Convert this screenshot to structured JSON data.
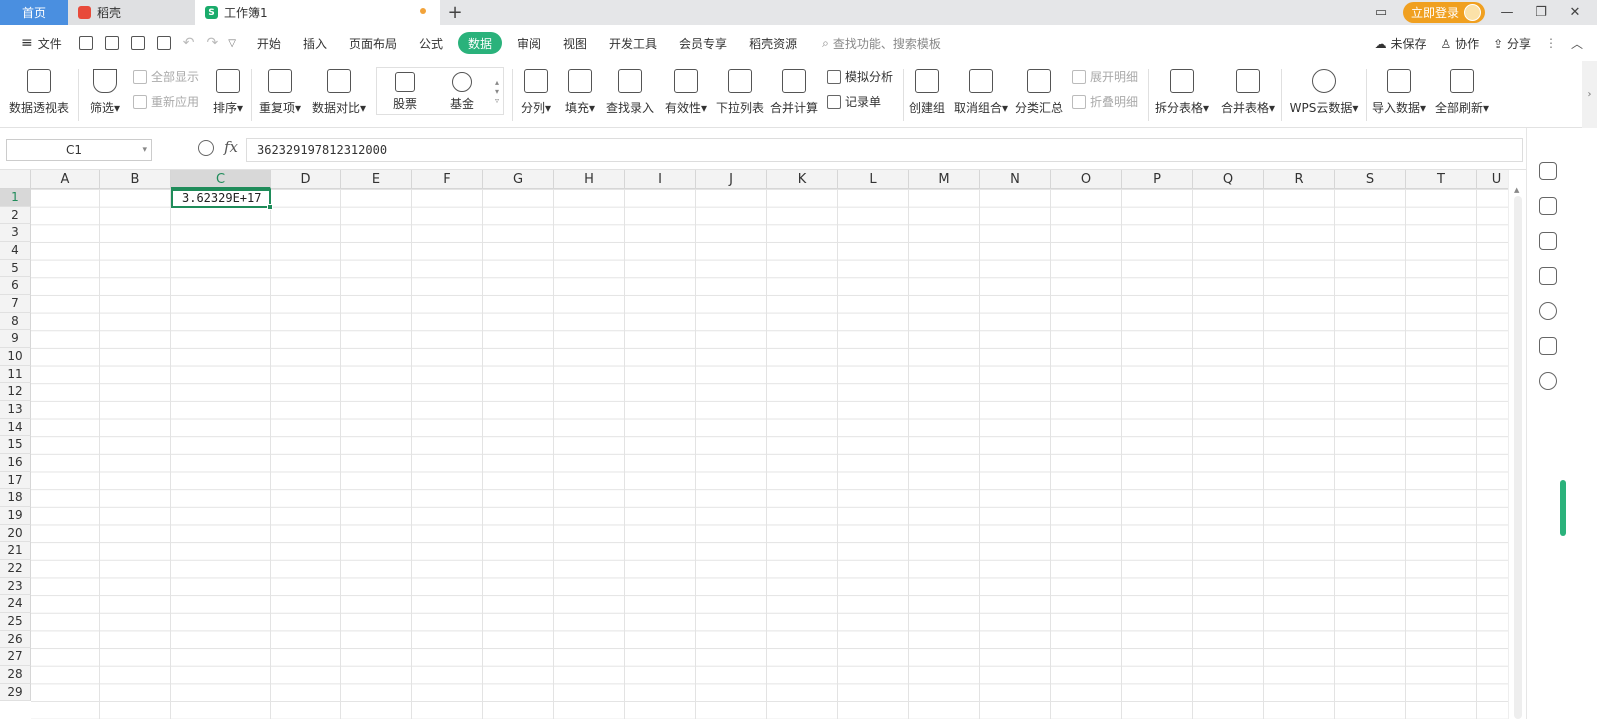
{
  "tabs": {
    "home": "首页",
    "daoke": "稻壳",
    "workbook": "工作簿1",
    "login": "立即登录"
  },
  "menu": {
    "file": "文件",
    "items": [
      "开始",
      "插入",
      "页面布局",
      "公式",
      "数据",
      "审阅",
      "视图",
      "开发工具",
      "会员专享",
      "稻壳资源"
    ],
    "active_index": 4,
    "search_placeholder": "查找功能、搜索模板",
    "unsaved": "未保存",
    "collab": "协作",
    "share": "分享"
  },
  "ribbon": {
    "pivot": "数据透视表",
    "filter": "筛选",
    "show_all": "全部显示",
    "reapply": "重新应用",
    "sort": "排序",
    "duplicates": "重复项",
    "compare": "数据对比",
    "stock": "股票",
    "fund": "基金",
    "split": "分列",
    "fill": "填充",
    "lookup": "查找录入",
    "validity": "有效性",
    "dropdown": "下拉列表",
    "consolidate": "合并计算",
    "simulate": "模拟分析",
    "record": "记录单",
    "group": "创建组",
    "ungroup": "取消组合",
    "subtotal": "分类汇总",
    "expand": "展开明细",
    "collapse": "折叠明细",
    "split_table": "拆分表格",
    "merge_table": "合并表格",
    "wps_cloud": "WPS云数据",
    "import": "导入数据",
    "refresh_all": "全部刷新"
  },
  "formula_bar": {
    "name_box": "C1",
    "fx": "fx",
    "content": "362329197812312000"
  },
  "sheet": {
    "columns": [
      "A",
      "B",
      "C",
      "D",
      "E",
      "F",
      "G",
      "H",
      "I",
      "J",
      "K",
      "L",
      "M",
      "N",
      "O",
      "P",
      "Q",
      "R",
      "S",
      "T",
      "U"
    ],
    "rows": [
      "1",
      "2",
      "3",
      "4",
      "5",
      "6",
      "7",
      "8",
      "9",
      "10",
      "11",
      "12",
      "13",
      "14",
      "15",
      "16",
      "17",
      "18",
      "19",
      "20",
      "21",
      "22",
      "23",
      "24",
      "25",
      "26",
      "27",
      "28",
      "29"
    ],
    "selected_cell": "C1",
    "selected_value": "3.62329E+17"
  },
  "colors": {
    "accent": "#2ab27b",
    "home_tab": "#4a8fe0",
    "login": "#f0a020"
  }
}
